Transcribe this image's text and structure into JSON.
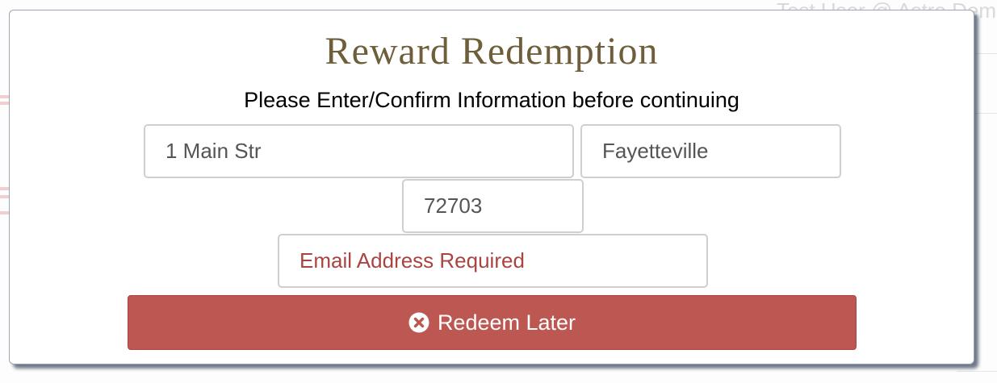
{
  "background": {
    "user_text": "Test User @ Astro Dem"
  },
  "modal": {
    "title": "Reward Redemption",
    "subtitle": "Please Enter/Confirm Information before continuing",
    "fields": {
      "street": {
        "value": "1 Main Str",
        "placeholder": ""
      },
      "city": {
        "value": "Fayetteville",
        "placeholder": ""
      },
      "zip": {
        "value": "72703",
        "placeholder": ""
      },
      "email": {
        "value": "",
        "placeholder": "Email Address Required"
      }
    },
    "redeem_later_button": {
      "label": "Redeem Later",
      "icon": "times-circle-icon"
    }
  },
  "colors": {
    "title": "#6e5e3a",
    "danger_button": "#bd5752",
    "error_text": "#a94442"
  }
}
